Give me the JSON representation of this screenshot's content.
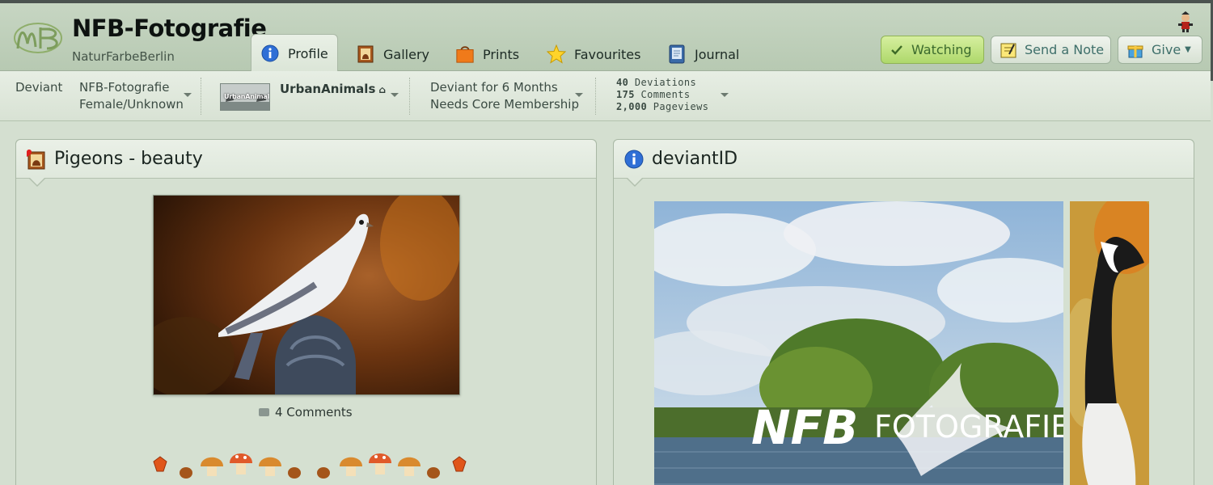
{
  "header": {
    "username": "NFB-Fotografie",
    "realname": "NaturFarbeBerlin",
    "logo_icon": "nfb-logo-icon",
    "tabs": [
      {
        "label": "Profile",
        "icon": "info-icon",
        "active": true
      },
      {
        "label": "Gallery",
        "icon": "gallery-frame-icon"
      },
      {
        "label": "Prints",
        "icon": "shopping-bag-icon"
      },
      {
        "label": "Favourites",
        "icon": "star-icon"
      },
      {
        "label": "Journal",
        "icon": "journal-book-icon"
      }
    ],
    "buttons": {
      "watching": "Watching",
      "send_note": "Send a Note",
      "give": "Give"
    },
    "user_icon": "deviant-avatar-icon"
  },
  "infobar": {
    "type_label": "Deviant",
    "name": "NFB-Fotografie",
    "gender": "Female/Unknown",
    "group_name": "UrbanAnimals",
    "group_image_text": "UrbanAnimals",
    "membership_line1": "Deviant for 6 Months",
    "membership_line2": "Needs Core Membership",
    "stats": {
      "deviations_count": "40",
      "deviations_label": "Deviations",
      "comments_count": "175",
      "comments_label": "Comments",
      "pageviews_count": "2,000",
      "pageviews_label": "Pageviews"
    }
  },
  "featured": {
    "title": "Pigeons - beauty",
    "comments_label": "4 Comments"
  },
  "deviantid": {
    "title": "deviantID",
    "image_text": "FOTOGRAFIE"
  },
  "colors": {
    "background": "#d4dfd0",
    "header": "#b7c9b2",
    "watch_button": "#aed86b",
    "link": "#3e6f6a"
  }
}
